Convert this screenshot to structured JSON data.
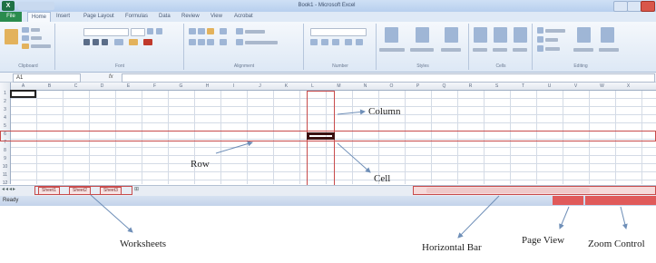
{
  "app": {
    "title": "Book1 - Microsoft Excel",
    "file_tab": "File",
    "tabs": [
      "Home",
      "Insert",
      "Page Layout",
      "Formulas",
      "Data",
      "Review",
      "View",
      "Acrobat"
    ]
  },
  "ribbon": {
    "groups": [
      "Clipboard",
      "Font",
      "Alignment",
      "Number",
      "Styles",
      "Cells",
      "Editing"
    ]
  },
  "formula_bar": {
    "name_box": "A1",
    "fx": "fx"
  },
  "grid": {
    "columns": [
      "A",
      "B",
      "C",
      "D",
      "E",
      "F",
      "G",
      "H",
      "I",
      "J",
      "K",
      "L",
      "M",
      "N",
      "O",
      "P",
      "Q",
      "R",
      "S",
      "T",
      "U",
      "V",
      "W",
      "X"
    ],
    "rows": [
      "1",
      "2",
      "3",
      "4",
      "5",
      "6",
      "7",
      "8",
      "9",
      "10",
      "11",
      "12"
    ]
  },
  "sheets": [
    "Sheet1",
    "Sheet2",
    "Sheet3"
  ],
  "status": "Ready",
  "callouts": {
    "column": "Column",
    "row": "Row",
    "cell": "Cell",
    "worksheets": "Worksheets",
    "horizontal_bar": "Horizontal Bar",
    "page_view": "Page View",
    "zoom_control": "Zoom Control"
  },
  "colors": {
    "annotation": "#c84b4b",
    "file_tab": "#2a8c4e",
    "ribbon_bg": "#dde8f5"
  }
}
